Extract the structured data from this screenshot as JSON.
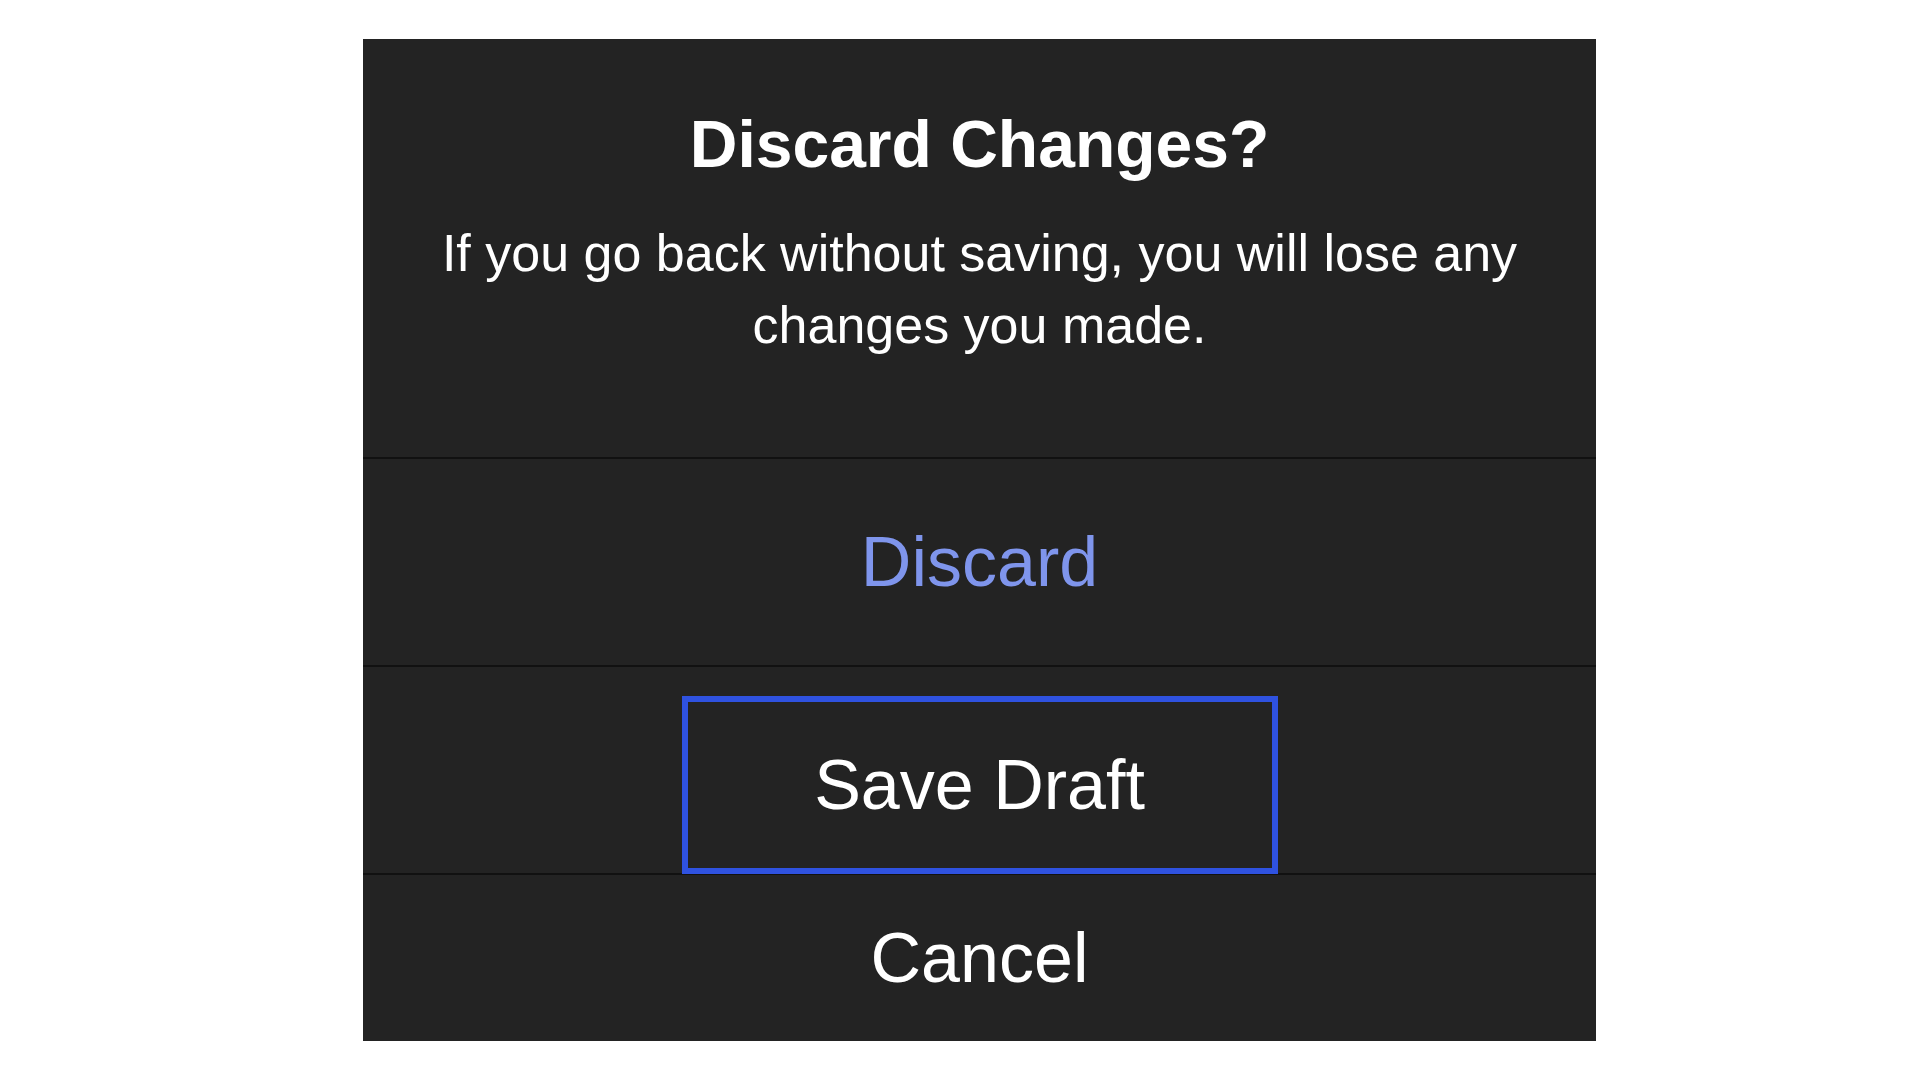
{
  "alert": {
    "title": "Discard Changes?",
    "message": "If you go back without saving, you will lose any changes you made."
  },
  "actions": [
    {
      "label": "Discard",
      "kind": "destructive",
      "highlighted": false
    },
    {
      "label": "Save Draft",
      "kind": "default",
      "highlighted": true
    },
    {
      "label": "Cancel",
      "kind": "default",
      "highlighted": false
    }
  ]
}
